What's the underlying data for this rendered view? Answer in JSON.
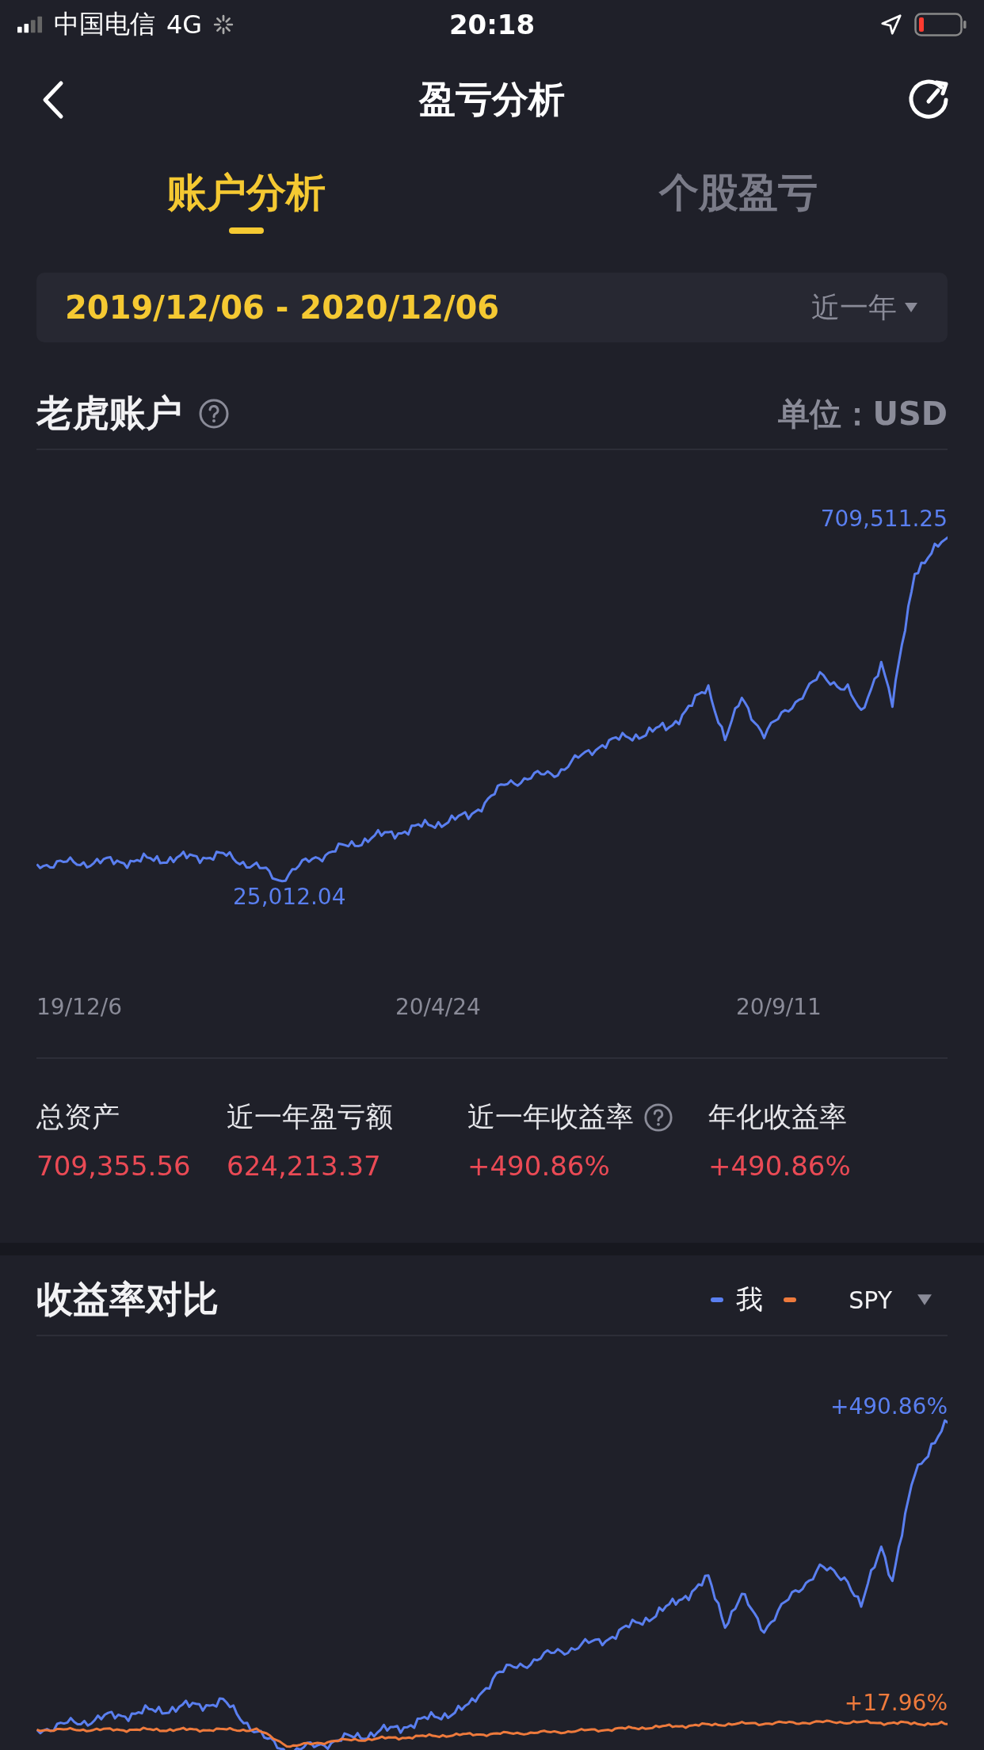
{
  "status_bar": {
    "carrier": "中国电信",
    "network": "4G",
    "time": "20:18"
  },
  "nav": {
    "title": "盈亏分析"
  },
  "tabs": [
    {
      "label": "账户分析",
      "selected": true
    },
    {
      "label": "个股盈亏",
      "selected": false
    }
  ],
  "date_range": {
    "text": "2019/12/06 - 2020/12/06",
    "period": "近一年"
  },
  "account": {
    "title": "老虎账户",
    "unit": "单位：USD",
    "max_label": "709,511.25",
    "min_label": "25,012.04",
    "x_labels": [
      "19/12/6",
      "20/4/24",
      "20/9/11"
    ]
  },
  "stats": [
    {
      "label": "总资产",
      "value": "709,355.56",
      "help": false
    },
    {
      "label": "近一年盈亏额",
      "value": "624,213.37",
      "help": false
    },
    {
      "label": "近一年收益率",
      "value": "+490.86%",
      "help": true
    },
    {
      "label": "年化收益率",
      "value": "+490.86%",
      "help": false
    }
  ],
  "comparison": {
    "title": "收益率对比",
    "legend": [
      {
        "label": "我",
        "color": "#5a7ff0",
        "kind": "plain"
      },
      {
        "label": "SPY",
        "color": "#ee7a3c",
        "kind": "dropdown"
      }
    ],
    "end_labels": [
      "+490.86%",
      "+17.96%"
    ]
  }
}
